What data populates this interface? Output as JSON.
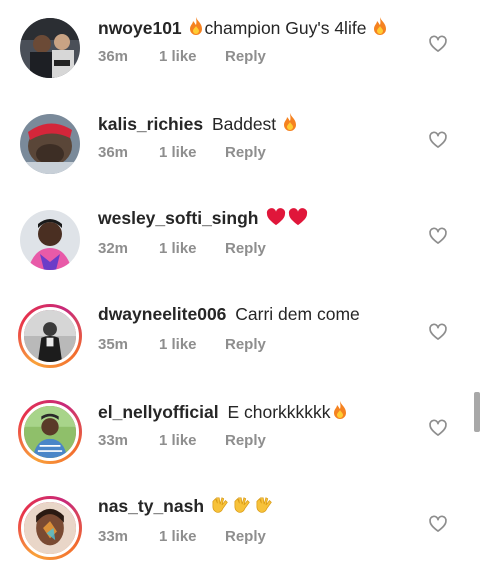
{
  "comments": [
    {
      "username": "nwoye101",
      "text": "champion Guy's 4life",
      "emoji_before": [
        "fire"
      ],
      "emoji_after": [
        "fire"
      ],
      "time": "36m",
      "likes": "1 like",
      "reply": "Reply",
      "story_ring": false
    },
    {
      "username": "kalis_richies",
      "text": "Baddest",
      "emoji_before": [],
      "emoji_after": [
        "fire"
      ],
      "time": "36m",
      "likes": "1 like",
      "reply": "Reply",
      "story_ring": false
    },
    {
      "username": "wesley_softi_singh",
      "text": "",
      "emoji_before": [],
      "emoji_after": [
        "red-heart",
        "red-heart"
      ],
      "time": "32m",
      "likes": "1 like",
      "reply": "Reply",
      "story_ring": false
    },
    {
      "username": "dwayneelite006",
      "text": "Carri dem come",
      "emoji_before": [],
      "emoji_after": [],
      "time": "35m",
      "likes": "1 like",
      "reply": "Reply",
      "story_ring": true
    },
    {
      "username": "el_nellyofficial",
      "text": "E chorkkkkkk",
      "emoji_before": [],
      "emoji_after": [
        "fire"
      ],
      "time": "33m",
      "likes": "1 like",
      "reply": "Reply",
      "story_ring": true
    },
    {
      "username": "nas_ty_nash",
      "text": "",
      "emoji_before": [],
      "emoji_after": [
        "raising-hands",
        "raising-hands",
        "raising-hands"
      ],
      "time": "33m",
      "likes": "1 like",
      "reply": "Reply",
      "story_ring": true
    }
  ],
  "colors": {
    "username": "#262626",
    "meta": "#8e8e8e",
    "ring": "#e8334a",
    "heart_outline": "#8e8e8e"
  },
  "icons": {
    "like": "heart-outline-icon"
  }
}
